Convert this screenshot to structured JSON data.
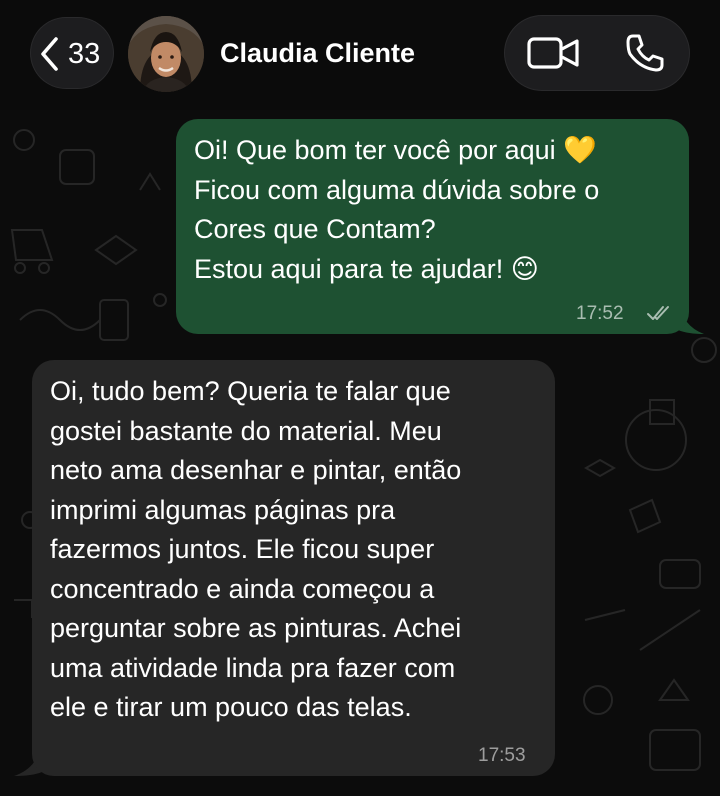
{
  "header": {
    "back_count": "33",
    "contact_name": "Claudia Cliente"
  },
  "icons": [
    "chevron-left-icon",
    "video-call-icon",
    "phone-icon",
    "double-check-icon"
  ],
  "colors": {
    "background": "#0c0c0c",
    "outgoing_bubble": "#1e5132",
    "incoming_bubble": "#262626",
    "header_pill": "#1d1d1f",
    "text": "#ffffff"
  },
  "messages": [
    {
      "direction": "outgoing",
      "text": "Oi! Que bom ter você por aqui 💛\nFicou com alguma dúvida sobre o\nCores que Contam?\nEstou aqui para te ajudar! 😊",
      "time": "17:52",
      "status": "read"
    },
    {
      "direction": "incoming",
      "text": "Oi, tudo bem? Queria te falar que\ngostei bastante do material. Meu\nneto ama desenhar e pintar, então\nimprimi algumas páginas pra\nfazermos juntos. Ele ficou super\nconcentrado e ainda começou a\nperguntar sobre as pinturas. Achei\numa atividade linda pra fazer com\nele e tirar um pouco das telas.",
      "time": "17:53"
    }
  ]
}
